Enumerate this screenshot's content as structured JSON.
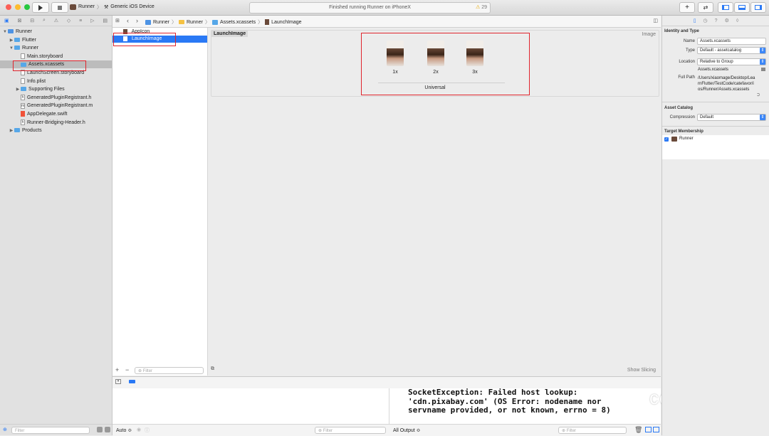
{
  "toolbar": {
    "scheme_target": "Runner",
    "scheme_device": "Generic iOS Device",
    "status_text": "Finished running Runner on iPhoneX",
    "warning_count": "29"
  },
  "navigator": {
    "items": [
      {
        "label": "Runner",
        "kind": "project",
        "indent": 0,
        "disclosure": "▼"
      },
      {
        "label": "Flutter",
        "kind": "folder",
        "indent": 1,
        "disclosure": "▶"
      },
      {
        "label": "Runner",
        "kind": "folder",
        "indent": 1,
        "disclosure": "▼"
      },
      {
        "label": "Main.storyboard",
        "kind": "file",
        "indent": 2,
        "disclosure": ""
      },
      {
        "label": "Assets.xcassets",
        "kind": "assets",
        "indent": 2,
        "disclosure": ""
      },
      {
        "label": "LaunchScreen.storyboard",
        "kind": "file",
        "indent": 2,
        "disclosure": ""
      },
      {
        "label": "Info.plist",
        "kind": "file",
        "indent": 2,
        "disclosure": ""
      },
      {
        "label": "Supporting Files",
        "kind": "folder",
        "indent": 2,
        "disclosure": "▶"
      },
      {
        "label": "GeneratedPluginRegistrant.h",
        "kind": "h",
        "indent": 2,
        "disclosure": ""
      },
      {
        "label": "GeneratedPluginRegistrant.m",
        "kind": "m",
        "indent": 2,
        "disclosure": ""
      },
      {
        "label": "AppDelegate.swift",
        "kind": "swift",
        "indent": 2,
        "disclosure": ""
      },
      {
        "label": "Runner-Bridging-Header.h",
        "kind": "h",
        "indent": 2,
        "disclosure": ""
      },
      {
        "label": "Products",
        "kind": "folder",
        "indent": 1,
        "disclosure": "▶"
      }
    ],
    "filter_placeholder": "Filter"
  },
  "jumpbar": {
    "crumbs": [
      "Runner",
      "Runner",
      "Assets.xcassets",
      "LaunchImage"
    ]
  },
  "assets": {
    "items": [
      "AppIcon",
      "LaunchImage"
    ],
    "filter_placeholder": "Filter"
  },
  "image_set": {
    "name": "LaunchImage",
    "type_label": "Image",
    "slots": [
      "1x",
      "2x",
      "3x"
    ],
    "group_label": "Universal",
    "show_slicing": "Show Slicing"
  },
  "debug": {
    "console_text": "SocketException: Failed host lookup: 'cdn.pixabay.com' (OS Error: nodename nor servname provided, or not known, errno = 8)",
    "auto_label": "Auto ≎",
    "all_output_label": "All Output ≎",
    "filter_placeholder": "Filter"
  },
  "watermark": "coderwhy",
  "inspector": {
    "identity_title": "Identity and Type",
    "name_label": "Name",
    "name_value": "Assets.xcassets",
    "type_label": "Type",
    "type_value": "Default - assetcatalog",
    "location_label": "Location",
    "location_value": "Relative to Group",
    "location_file": "Assets.xcassets",
    "fullpath_label": "Full Path",
    "fullpath_value": "/Users/xiaomage/Desktop/LearnFlutter/TestCode/catefavor/ios/Runner/Assets.xcassets",
    "asset_catalog_title": "Asset Catalog",
    "compression_label": "Compression",
    "compression_value": "Default",
    "target_membership_title": "Target Membership",
    "target_runner": "Runner"
  },
  "colors": {
    "selection": "#2a79f5",
    "highlight_box": "#e0242c",
    "folder": "#56a7e8"
  }
}
